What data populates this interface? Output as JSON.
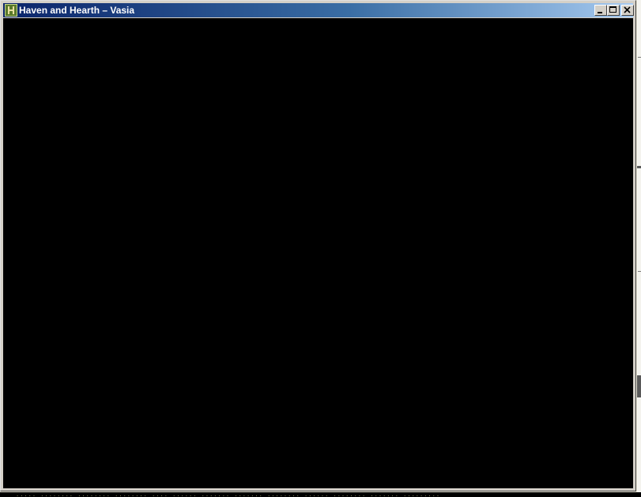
{
  "window": {
    "title": "Haven and Hearth – Vasia",
    "app_icon": "haven-and-hearth-app-icon",
    "buttons": {
      "minimize": "minimize-icon",
      "maximize": "maximize-icon",
      "close": "close-icon"
    },
    "client_color": "#000000"
  },
  "background": {
    "console_text": "····· ········ ········ ········ ···· ······ ······· ······· ········ ······ ········ ······· ·········"
  }
}
